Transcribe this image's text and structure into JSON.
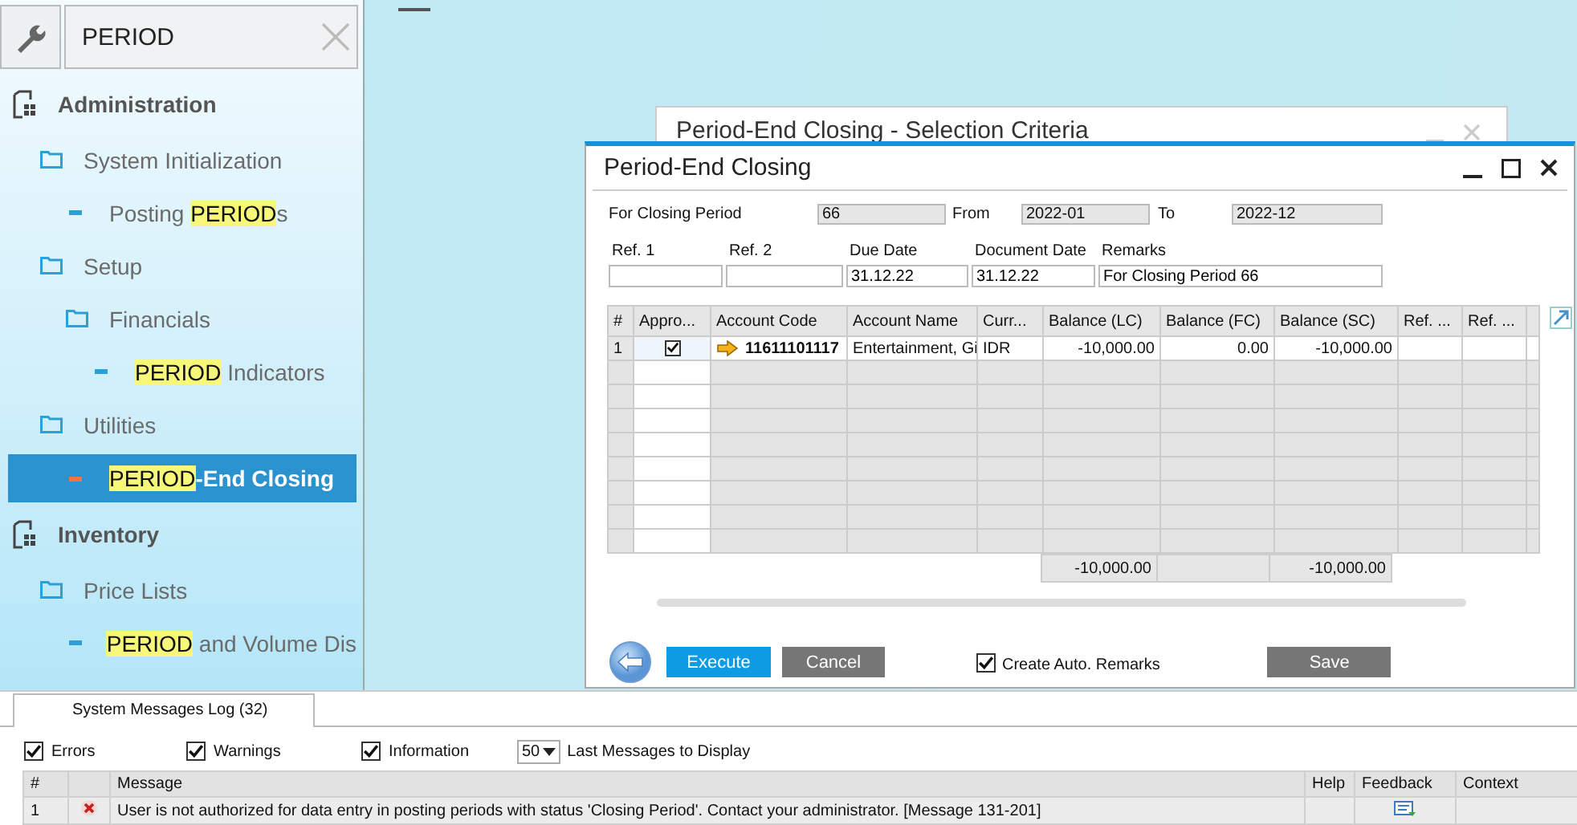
{
  "search": {
    "value": "PERIOD"
  },
  "sidebar": {
    "items": [
      {
        "kind": "module",
        "selected": false,
        "label_parts": [
          {
            "text": "Administration",
            "match": false
          }
        ],
        "children": [
          {
            "kind": "folder",
            "selected": false,
            "label_parts": [
              {
                "text": "System Initialization",
                "match": false
              }
            ],
            "children": [
              {
                "kind": "leaf",
                "selected": false,
                "label_parts": [
                  {
                    "text": "Posting ",
                    "match": false
                  },
                  {
                    "text": "PERIOD",
                    "match": true
                  },
                  {
                    "text": "s",
                    "match": false
                  }
                ]
              }
            ]
          },
          {
            "kind": "folder",
            "selected": false,
            "label_parts": [
              {
                "text": "Setup",
                "match": false
              }
            ],
            "children": [
              {
                "kind": "folder",
                "selected": false,
                "label_parts": [
                  {
                    "text": "Financials",
                    "match": false
                  }
                ],
                "children": [
                  {
                    "kind": "leaf",
                    "selected": false,
                    "label_parts": [
                      {
                        "text": "PERIOD",
                        "match": true
                      },
                      {
                        "text": " Indicators",
                        "match": false
                      }
                    ]
                  }
                ]
              }
            ]
          },
          {
            "kind": "folder",
            "selected": false,
            "label_parts": [
              {
                "text": "Utilities",
                "match": false
              }
            ],
            "children": [
              {
                "kind": "leaf",
                "selected": true,
                "label_parts": [
                  {
                    "text": "PERIOD",
                    "match": true
                  },
                  {
                    "text": "-End Closing",
                    "match": false
                  }
                ]
              }
            ]
          }
        ]
      },
      {
        "kind": "module",
        "selected": false,
        "label_parts": [
          {
            "text": "Inventory",
            "match": false
          }
        ],
        "children": [
          {
            "kind": "folder",
            "selected": false,
            "label_parts": [
              {
                "text": "Price Lists",
                "match": false
              }
            ],
            "children": [
              {
                "kind": "leaf",
                "selected": false,
                "label_parts": [
                  {
                    "text": "PERIOD",
                    "match": true
                  },
                  {
                    "text": " and Volume Dis",
                    "match": false
                  }
                ]
              }
            ]
          }
        ]
      }
    ]
  },
  "background_window": {
    "title": "Period-End Closing - Selection Criteria"
  },
  "dialog": {
    "title": "Period-End Closing",
    "period_fields": [
      {
        "label": "For Closing Period",
        "value": "66"
      },
      {
        "label": "From",
        "value": "2022-01"
      },
      {
        "label": "To",
        "value": "2022-12"
      }
    ],
    "entry_fields": [
      {
        "label": "Ref. 1"
      },
      {
        "label": "Ref. 2"
      },
      {
        "label": "Due Date",
        "value": "31.12.22"
      },
      {
        "label": "Document Date",
        "value": "31.12.22"
      },
      {
        "label": "Remarks",
        "value": "For Closing Period 66"
      }
    ],
    "grid": {
      "columns": [
        "#",
        "Appro...",
        "Account Code",
        "Account Name",
        "Curr...",
        "Balance (LC)",
        "Balance (FC)",
        "Balance (SC)",
        "Ref. ...",
        "Ref. ..."
      ],
      "rows": [
        {
          "number": "1",
          "approved": true,
          "account_code": "11611101117",
          "account_name": "Entertainment, Gi",
          "currency": "IDR",
          "balance_lc": "-10,000.00",
          "balance_fc": "0.00",
          "balance_sc": "-10,000.00"
        }
      ],
      "totals": {
        "balance_lc": "-10,000.00",
        "balance_sc": "-10,000.00"
      }
    },
    "buttons": {
      "execute": "Execute",
      "cancel": "Cancel",
      "save": "Save"
    },
    "create_auto_remarks": {
      "label": "Create Auto. Remarks",
      "checked": true
    }
  },
  "messages_log": {
    "tab": {
      "label": "System Messages Log (32)",
      "selected": true
    },
    "filters": [
      {
        "label": "Errors",
        "checked": true
      },
      {
        "label": "Warnings",
        "checked": true
      },
      {
        "label": "Information",
        "checked": true
      }
    ],
    "count": "50",
    "count_label": "Last Messages to Display",
    "columns": [
      "#",
      "Message",
      "Help",
      "Feedback",
      "Context"
    ],
    "rows": [
      {
        "number": "1",
        "kind": "error",
        "message": "User is not authorized for data entry in posting periods with status 'Closing Period'. Contact your administrator.   [Message 131-201]"
      }
    ]
  }
}
